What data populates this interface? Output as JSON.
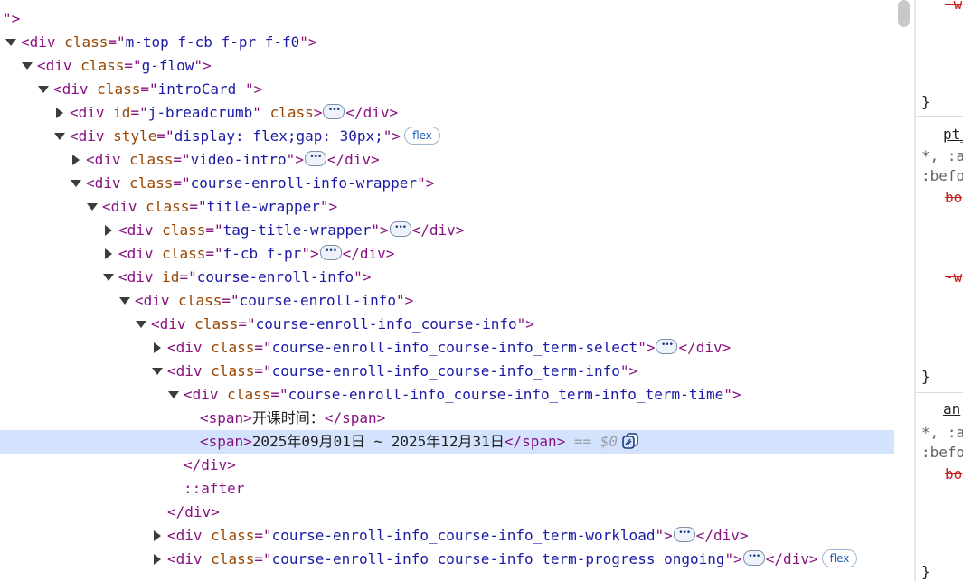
{
  "dom_tree": {
    "rows": [
      {
        "id": "r0",
        "indent": 0,
        "toggle": "none",
        "parts": [
          {
            "c": "p",
            "t": "\">"
          }
        ]
      },
      {
        "id": "r1",
        "indent": 0,
        "toggle": "open",
        "parts": [
          {
            "c": "p",
            "t": "<div "
          },
          {
            "c": "a",
            "t": "class"
          },
          {
            "c": "p",
            "t": "=\""
          },
          {
            "c": "v",
            "t": "m-top f-cb f-pr f-f0"
          },
          {
            "c": "p",
            "t": "\">"
          }
        ]
      },
      {
        "id": "r2",
        "indent": 1,
        "toggle": "open",
        "parts": [
          {
            "c": "p",
            "t": "<div "
          },
          {
            "c": "a",
            "t": "class"
          },
          {
            "c": "p",
            "t": "=\""
          },
          {
            "c": "v",
            "t": "g-flow"
          },
          {
            "c": "p",
            "t": "\">"
          }
        ]
      },
      {
        "id": "r3",
        "indent": 2,
        "toggle": "open",
        "parts": [
          {
            "c": "p",
            "t": "<div "
          },
          {
            "c": "a",
            "t": "class"
          },
          {
            "c": "p",
            "t": "=\""
          },
          {
            "c": "v",
            "t": "introCard "
          },
          {
            "c": "p",
            "t": "\">"
          }
        ]
      },
      {
        "id": "r4",
        "indent": 3,
        "toggle": "closed",
        "parts": [
          {
            "c": "p",
            "t": "<div "
          },
          {
            "c": "a",
            "t": "id"
          },
          {
            "c": "p",
            "t": "=\""
          },
          {
            "c": "v",
            "t": "j-breadcrumb"
          },
          {
            "c": "p",
            "t": "\" "
          },
          {
            "c": "a",
            "t": "class"
          },
          {
            "c": "p",
            "t": ">"
          },
          {
            "c": "ell"
          },
          {
            "c": "p",
            "t": "</div>"
          }
        ]
      },
      {
        "id": "r5",
        "indent": 3,
        "toggle": "open",
        "parts": [
          {
            "c": "p",
            "t": "<div "
          },
          {
            "c": "a",
            "t": "style"
          },
          {
            "c": "p",
            "t": "=\""
          },
          {
            "c": "v",
            "t": "display: flex;gap: 30px;"
          },
          {
            "c": "p",
            "t": "\">"
          },
          {
            "c": "badge",
            "t": "flex"
          }
        ]
      },
      {
        "id": "r6",
        "indent": 4,
        "toggle": "closed",
        "parts": [
          {
            "c": "p",
            "t": "<div "
          },
          {
            "c": "a",
            "t": "class"
          },
          {
            "c": "p",
            "t": "=\""
          },
          {
            "c": "v",
            "t": "video-intro"
          },
          {
            "c": "p",
            "t": "\">"
          },
          {
            "c": "ell"
          },
          {
            "c": "p",
            "t": "</div>"
          }
        ]
      },
      {
        "id": "r7",
        "indent": 4,
        "toggle": "open",
        "parts": [
          {
            "c": "p",
            "t": "<div "
          },
          {
            "c": "a",
            "t": "class"
          },
          {
            "c": "p",
            "t": "=\""
          },
          {
            "c": "v",
            "t": "course-enroll-info-wrapper"
          },
          {
            "c": "p",
            "t": "\">"
          }
        ]
      },
      {
        "id": "r8",
        "indent": 5,
        "toggle": "open",
        "parts": [
          {
            "c": "p",
            "t": "<div "
          },
          {
            "c": "a",
            "t": "class"
          },
          {
            "c": "p",
            "t": "=\""
          },
          {
            "c": "v",
            "t": "title-wrapper"
          },
          {
            "c": "p",
            "t": "\">"
          }
        ]
      },
      {
        "id": "r9",
        "indent": 6,
        "toggle": "closed",
        "parts": [
          {
            "c": "p",
            "t": "<div "
          },
          {
            "c": "a",
            "t": "class"
          },
          {
            "c": "p",
            "t": "=\""
          },
          {
            "c": "v",
            "t": "tag-title-wrapper"
          },
          {
            "c": "p",
            "t": "\">"
          },
          {
            "c": "ell"
          },
          {
            "c": "p",
            "t": "</div>"
          }
        ]
      },
      {
        "id": "r10",
        "indent": 6,
        "toggle": "closed",
        "parts": [
          {
            "c": "p",
            "t": "<div "
          },
          {
            "c": "a",
            "t": "class"
          },
          {
            "c": "p",
            "t": "=\""
          },
          {
            "c": "v",
            "t": "f-cb f-pr"
          },
          {
            "c": "p",
            "t": "\">"
          },
          {
            "c": "ell"
          },
          {
            "c": "p",
            "t": "</div>"
          }
        ]
      },
      {
        "id": "r11",
        "indent": 6,
        "toggle": "open",
        "parts": [
          {
            "c": "p",
            "t": "<div "
          },
          {
            "c": "a",
            "t": "id"
          },
          {
            "c": "p",
            "t": "=\""
          },
          {
            "c": "v",
            "t": "course-enroll-info"
          },
          {
            "c": "p",
            "t": "\">"
          }
        ]
      },
      {
        "id": "r12",
        "indent": 7,
        "toggle": "open",
        "parts": [
          {
            "c": "p",
            "t": "<div "
          },
          {
            "c": "a",
            "t": "class"
          },
          {
            "c": "p",
            "t": "=\""
          },
          {
            "c": "v",
            "t": "course-enroll-info"
          },
          {
            "c": "p",
            "t": "\">"
          }
        ]
      },
      {
        "id": "r13",
        "indent": 8,
        "toggle": "open",
        "parts": [
          {
            "c": "p",
            "t": "<div "
          },
          {
            "c": "a",
            "t": "class"
          },
          {
            "c": "p",
            "t": "=\""
          },
          {
            "c": "v",
            "t": "course-enroll-info_course-info"
          },
          {
            "c": "p",
            "t": "\">"
          }
        ]
      },
      {
        "id": "r14",
        "indent": 9,
        "toggle": "closed",
        "parts": [
          {
            "c": "p",
            "t": "<div "
          },
          {
            "c": "a",
            "t": "class"
          },
          {
            "c": "p",
            "t": "=\""
          },
          {
            "c": "v",
            "t": "course-enroll-info_course-info_term-select"
          },
          {
            "c": "p",
            "t": "\">"
          },
          {
            "c": "ell"
          },
          {
            "c": "p",
            "t": "</div>"
          }
        ]
      },
      {
        "id": "r15",
        "indent": 9,
        "toggle": "open",
        "parts": [
          {
            "c": "p",
            "t": "<div "
          },
          {
            "c": "a",
            "t": "class"
          },
          {
            "c": "p",
            "t": "=\""
          },
          {
            "c": "v",
            "t": "course-enroll-info_course-info_term-info"
          },
          {
            "c": "p",
            "t": "\">"
          }
        ]
      },
      {
        "id": "r16",
        "indent": 10,
        "toggle": "open",
        "parts": [
          {
            "c": "p",
            "t": "<div "
          },
          {
            "c": "a",
            "t": "class"
          },
          {
            "c": "p",
            "t": "=\""
          },
          {
            "c": "v",
            "t": "course-enroll-info_course-info_term-info_term-time"
          },
          {
            "c": "p",
            "t": "\">"
          }
        ]
      },
      {
        "id": "r17",
        "indent": 11,
        "toggle": "none",
        "parts": [
          {
            "c": "p",
            "t": "<span>"
          },
          {
            "c": "t",
            "t": "开课时间："
          },
          {
            "c": "p",
            "t": "</span>"
          }
        ]
      },
      {
        "id": "r18",
        "indent": 11,
        "toggle": "none",
        "selected": true,
        "parts": [
          {
            "c": "p",
            "t": "<span>"
          },
          {
            "c": "t",
            "t": "2025年09月01日 ~ 2025年12月31日"
          },
          {
            "c": "p",
            "t": "</span>"
          },
          {
            "c": "dim",
            "t": " == $0"
          },
          {
            "c": "icon"
          }
        ]
      },
      {
        "id": "r19",
        "indent": 10,
        "toggle": "none",
        "parts": [
          {
            "c": "p",
            "t": "</div>"
          }
        ]
      },
      {
        "id": "r20",
        "indent": 10,
        "toggle": "none",
        "parts": [
          {
            "c": "ps",
            "t": "::after"
          }
        ]
      },
      {
        "id": "r21",
        "indent": 9,
        "toggle": "none",
        "parts": [
          {
            "c": "p",
            "t": "</div>"
          }
        ]
      },
      {
        "id": "r22",
        "indent": 9,
        "toggle": "closed",
        "parts": [
          {
            "c": "p",
            "t": "<div "
          },
          {
            "c": "a",
            "t": "class"
          },
          {
            "c": "p",
            "t": "=\""
          },
          {
            "c": "v",
            "t": "course-enroll-info_course-info_term-workload"
          },
          {
            "c": "p",
            "t": "\">"
          },
          {
            "c": "ell"
          },
          {
            "c": "p",
            "t": "</div>"
          }
        ]
      },
      {
        "id": "r23",
        "indent": 9,
        "toggle": "closed",
        "parts": [
          {
            "c": "p",
            "t": "<div "
          },
          {
            "c": "a",
            "t": "class"
          },
          {
            "c": "p",
            "t": "=\""
          },
          {
            "c": "v",
            "t": "course-enroll-info_course-info_term-progress ongoing"
          },
          {
            "c": "p",
            "t": "\">"
          },
          {
            "c": "ell"
          },
          {
            "c": "p",
            "t": "</div>"
          },
          {
            "c": "badge",
            "t": "flex"
          }
        ]
      }
    ]
  },
  "styles_panel": {
    "items": [
      {
        "cls": "red",
        "text": "-w"
      },
      {
        "cls": "brace",
        "text": "}"
      },
      {
        "cls": "under",
        "text": "pt_"
      },
      {
        "cls": "grey",
        "text": "*, :a"
      },
      {
        "cls": "grey",
        "text": ":befo"
      },
      {
        "cls": "red",
        "text": "bo"
      },
      {
        "cls": "red",
        "text": "-w"
      },
      {
        "cls": "brace",
        "text": "}"
      },
      {
        "cls": "under",
        "text": "an"
      },
      {
        "cls": "grey",
        "text": "*, :a"
      },
      {
        "cls": "grey",
        "text": ":befo"
      },
      {
        "cls": "red",
        "text": "bo"
      },
      {
        "cls": "brace",
        "text": "}"
      }
    ]
  }
}
